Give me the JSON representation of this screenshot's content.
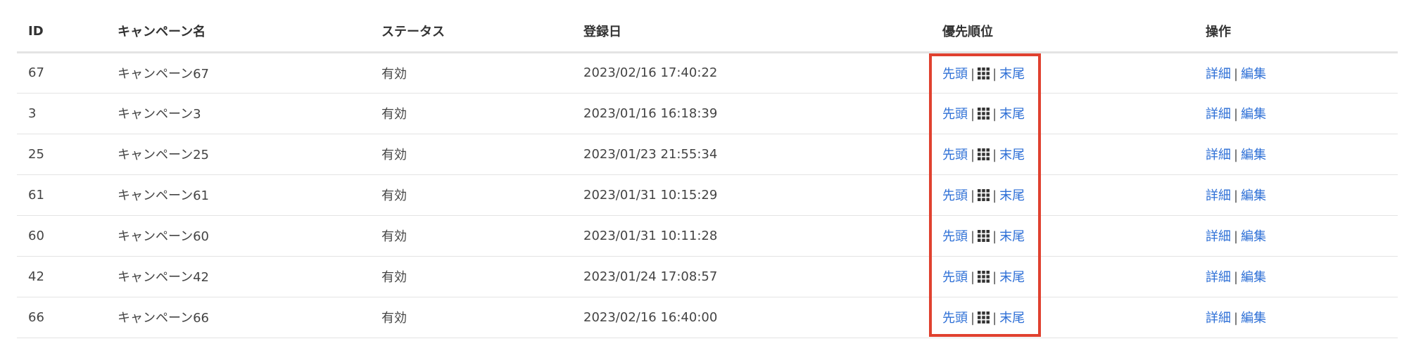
{
  "table": {
    "headers": {
      "id": "ID",
      "name": "キャンペーン名",
      "status": "ステータス",
      "registered": "登録日",
      "priority": "優先順位",
      "actions": "操作"
    },
    "priority_links": {
      "top": "先頭",
      "bottom": "末尾",
      "separator": "|",
      "handle_icon": "grid-icon"
    },
    "action_links": {
      "detail": "詳細",
      "edit": "編集",
      "separator": "|"
    },
    "rows": [
      {
        "id": "67",
        "name": "キャンペーン67",
        "status": "有効",
        "registered": "2023/02/16 17:40:22"
      },
      {
        "id": "3",
        "name": "キャンペーン3",
        "status": "有効",
        "registered": "2023/01/16 16:18:39"
      },
      {
        "id": "25",
        "name": "キャンペーン25",
        "status": "有効",
        "registered": "2023/01/23 21:55:34"
      },
      {
        "id": "61",
        "name": "キャンペーン61",
        "status": "有効",
        "registered": "2023/01/31 10:15:29"
      },
      {
        "id": "60",
        "name": "キャンペーン60",
        "status": "有効",
        "registered": "2023/01/31 10:11:28"
      },
      {
        "id": "42",
        "name": "キャンペーン42",
        "status": "有効",
        "registered": "2023/01/24 17:08:57"
      },
      {
        "id": "66",
        "name": "キャンペーン66",
        "status": "有効",
        "registered": "2023/02/16 16:40:00"
      }
    ]
  },
  "colors": {
    "link": "#2d6fd6",
    "highlight": "#e0412f",
    "border": "#e4e4e4"
  }
}
